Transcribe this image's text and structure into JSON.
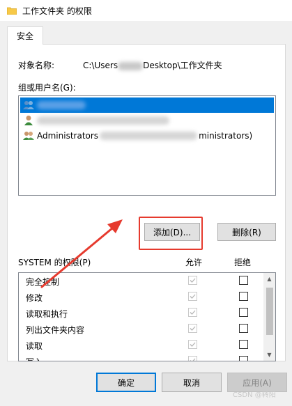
{
  "window": {
    "title": "工作文件夹 的权限"
  },
  "tabs": [
    {
      "label": "安全"
    }
  ],
  "object": {
    "label": "对象名称:",
    "path_prefix": "C:\\Users",
    "path_suffix": "Desktop\\工作文件夹"
  },
  "users": {
    "label": "组或用户名(G):",
    "items": [
      {
        "label": "",
        "selected": true
      },
      {
        "label": "",
        "selected": false
      },
      {
        "label_prefix": "Administrators",
        "label_suffix": "ministrators)",
        "selected": false
      }
    ]
  },
  "buttons": {
    "add": "添加(D)...",
    "remove": "删除(R)",
    "ok": "确定",
    "cancel": "取消",
    "apply": "应用(A)"
  },
  "permissions": {
    "title": "SYSTEM 的权限(P)",
    "allow_header": "允许",
    "deny_header": "拒绝",
    "items": [
      {
        "name": "完全控制",
        "allow": true,
        "deny": false
      },
      {
        "name": "修改",
        "allow": true,
        "deny": false
      },
      {
        "name": "读取和执行",
        "allow": true,
        "deny": false
      },
      {
        "name": "列出文件夹内容",
        "allow": true,
        "deny": false
      },
      {
        "name": "读取",
        "allow": true,
        "deny": false
      },
      {
        "name": "写入",
        "allow": true,
        "deny": false
      }
    ]
  },
  "watermark": "CSDN @转阳",
  "colors": {
    "selection": "#0078d7",
    "highlight": "#e63a2e"
  }
}
